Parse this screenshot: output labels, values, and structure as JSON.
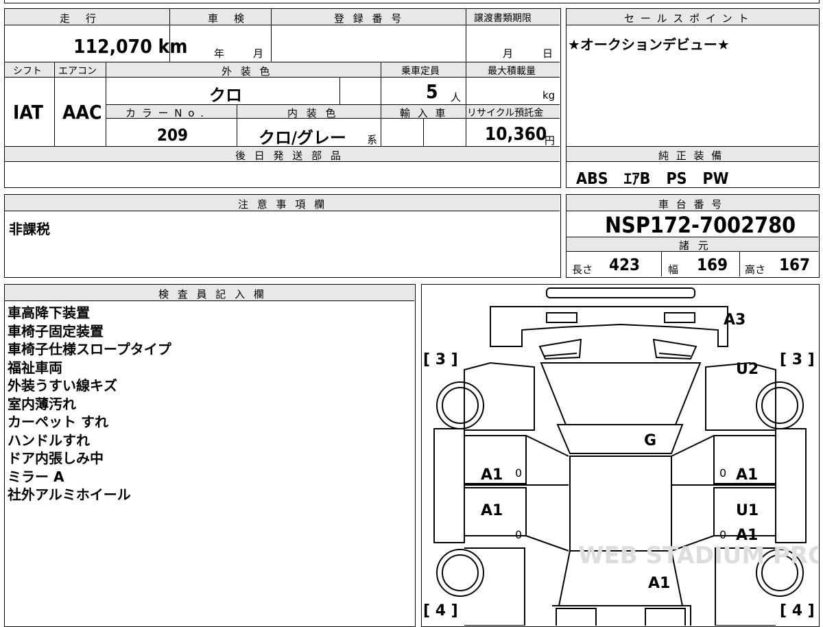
{
  "vehicle": {
    "headers": {
      "mileage": "走　行",
      "shaken": "車　検",
      "registration": "登 録 番 号",
      "transfer_deadline": "譲渡書類期限",
      "shift": "シフト",
      "aircon": "エアコン",
      "exterior_color": "外 装 色",
      "capacity": "乗車定員",
      "max_load": "最大積載量",
      "color_no": "カ ラ ー N o .",
      "interior_color": "内 装 色",
      "import": "輸 入 車",
      "recycle_fee": "リサイクル預託金",
      "later_parts": "後 日 発 送 部 品"
    },
    "mileage_value": "112,070",
    "mileage_unit": "km",
    "shaken_year": "年",
    "shaken_month": "月",
    "transfer_month": "月",
    "transfer_day": "日",
    "shift_value": "IAT",
    "aircon_value": "AAC",
    "exterior_color_value": "クロ",
    "capacity_value": "5",
    "capacity_unit": "人",
    "max_load_unit": "kg",
    "color_no_value": "209",
    "interior_color_value": "クロ/グレー",
    "interior_color_suffix": "系",
    "recycle_fee_value": "10,360",
    "recycle_fee_unit": "円"
  },
  "sales_point": {
    "header": "セ ー ル ス ポ イ ン ト",
    "text": "★オークションデビュー★"
  },
  "equipment": {
    "header": "純 正 装 備",
    "text": "ABS　ｴｱB　PS　PW"
  },
  "caution": {
    "header": "注 意 事 項 欄",
    "text": "非課税"
  },
  "chassis": {
    "header": "車 台 番 号",
    "value": "NSP172-7002780"
  },
  "specs": {
    "header": "諸 元",
    "length_label": "長さ",
    "length_value": "423",
    "width_label": "幅",
    "width_value": "169",
    "height_label": "高さ",
    "height_value": "167"
  },
  "inspector": {
    "header": "検 査 員 記 入 欄",
    "lines": [
      "車高降下装置",
      "車椅子固定装置",
      "車椅子仕様スロープタイプ",
      "福祉車両",
      "外装うすい線キズ",
      "室内薄汚れ",
      "カーペット すれ",
      "ハンドルすれ",
      "ドア内張しみ中",
      "ミラー A",
      "社外アルミホイール"
    ]
  },
  "diagram": {
    "marks": {
      "rear_bumper": "A3",
      "top_right": "U2",
      "windshield": "G",
      "left_front_door": "A1",
      "right_front_door": "A1",
      "left_rear_door": "A1",
      "right_rear_door_1": "U1",
      "right_rear_door_2": "A1",
      "front": "A1"
    },
    "tires": {
      "rear_left": "[ 3 ]",
      "rear_right": "[ 3 ]",
      "front_left": "[ 4 ]",
      "front_right": "[ 4 ]"
    },
    "door_zero": "0",
    "watermark": "WEB STADIUM PRO"
  }
}
